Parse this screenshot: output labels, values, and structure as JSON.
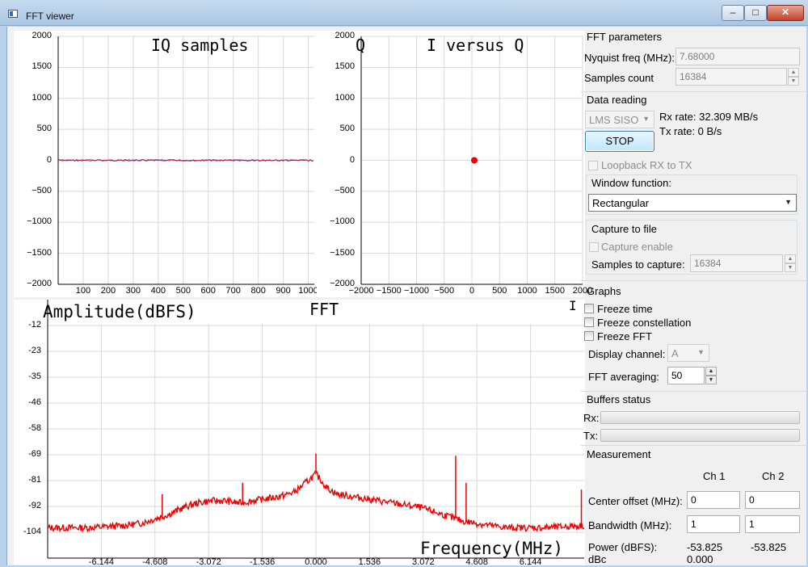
{
  "window": {
    "title": "FFT viewer",
    "minimize": "–",
    "maximize": "□",
    "close": "✕"
  },
  "colors": {
    "trace_red": "#ee0000",
    "trace_blue": "#4040c0",
    "grid": "#d8d8d8"
  },
  "plots": {
    "iq": {
      "title": "IQ samples",
      "y_ticks": [
        "2000",
        "1500",
        "1000",
        "500",
        "0",
        "−500",
        "−1000",
        "−1500",
        "−2000"
      ],
      "x_ticks": [
        "100",
        "200",
        "300",
        "400",
        "500",
        "600",
        "700",
        "800",
        "900",
        "1000"
      ],
      "ylim": [
        -2000,
        2000
      ],
      "xlim": [
        0,
        1024
      ]
    },
    "ivq": {
      "title": "I versus Q",
      "axis_label": "Q",
      "y_ticks": [
        "2000",
        "1500",
        "1000",
        "500",
        "0",
        "−500",
        "−1000",
        "−1500",
        "−2000"
      ],
      "x_ticks": [
        "−2000",
        "−1500",
        "−1000",
        "−500",
        "0",
        "500",
        "1000",
        "1500",
        "2000"
      ],
      "point": {
        "i": 0,
        "q": 0
      }
    },
    "fft": {
      "title": "FFT",
      "ylabel": "Amplitude(dBFS)",
      "xlabel": "Frequency(MHz)",
      "y_ticks": [
        "-12",
        "-23",
        "-35",
        "-46",
        "-58",
        "-69",
        "-81",
        "-92",
        "-104"
      ],
      "x_ticks": [
        "-6.144",
        "-4.608",
        "-3.072",
        "-1.536",
        "0.000",
        "1.536",
        "3.072",
        "4.608",
        "6.144"
      ]
    }
  },
  "chart_data": [
    {
      "type": "line",
      "title": "IQ samples",
      "xlim": [
        0,
        1024
      ],
      "ylim": [
        -2000,
        2000
      ],
      "series": [
        {
          "name": "",
          "x": [
            0,
            1024
          ],
          "values": [
            0,
            0
          ]
        }
      ]
    },
    {
      "type": "scatter",
      "title": "I versus Q",
      "xlim": [
        -2000,
        2000
      ],
      "ylim": [
        -2000,
        2000
      ],
      "series": [
        {
          "name": "",
          "x": [
            0
          ],
          "values": [
            0
          ]
        }
      ]
    },
    {
      "type": "line",
      "title": "FFT",
      "xlabel": "Frequency(MHz)",
      "ylabel": "Amplitude(dBFS)",
      "xlim": [
        -7.68,
        7.68
      ],
      "ylim": [
        -110,
        -5
      ],
      "series": [
        {
          "name": "",
          "x": [
            -7.68,
            -6.5,
            -5.5,
            -5.0,
            -4.6,
            -4.2,
            -3.8,
            -3.4,
            -3.0,
            -2.6,
            -2.2,
            -1.8,
            -1.4,
            -1.0,
            -0.6,
            -0.3,
            0.0,
            0.3,
            0.6,
            1.0,
            1.4,
            1.8,
            2.2,
            2.6,
            3.0,
            3.4,
            3.8,
            4.2,
            4.6,
            5.0,
            5.5,
            6.5,
            7.68
          ],
          "values": [
            -102,
            -102,
            -101,
            -100,
            -98,
            -96,
            -93,
            -91,
            -90,
            -90,
            -91,
            -90,
            -89,
            -88,
            -86,
            -82,
            -78,
            -84,
            -87,
            -88,
            -89,
            -90,
            -91,
            -92,
            -93,
            -95,
            -97,
            -99,
            -100,
            -101,
            -102,
            -102,
            -101
          ]
        }
      ],
      "spurs": [
        {
          "x": -4.4,
          "y": -87
        },
        {
          "x": -2.1,
          "y": -82
        },
        {
          "x": 0.0,
          "y": -69
        },
        {
          "x": 4.0,
          "y": -70
        },
        {
          "x": 4.3,
          "y": -82
        },
        {
          "x": 7.6,
          "y": -85
        }
      ]
    }
  ],
  "fft_params": {
    "group": "FFT parameters",
    "nyquist_label": "Nyquist freq (MHz):",
    "nyquist_value": "7.68000",
    "samples_label": "Samples count",
    "samples_value": "16384"
  },
  "data_reading": {
    "group": "Data reading",
    "device": "LMS SISO",
    "rx_rate": "Rx rate: 32.309 MB/s",
    "tx_rate": "Tx rate: 0 B/s",
    "stop_label": "STOP",
    "loopback_label": "Loopback RX to TX"
  },
  "window_function": {
    "label": "Window function:",
    "value": "Rectangular"
  },
  "capture": {
    "group": "Capture to file",
    "enable_label": "Capture enable",
    "samples_label": "Samples to capture:",
    "samples_value": "16384"
  },
  "graphs": {
    "group": "Graphs",
    "freeze_time": "Freeze time",
    "freeze_constellation": "Freeze constellation",
    "freeze_fft": "Freeze FFT",
    "channel_label": "Display channel:",
    "channel_value": "A",
    "averaging_label": "FFT averaging:",
    "averaging_value": "50"
  },
  "buffers": {
    "group": "Buffers status",
    "rx_label": "Rx:",
    "tx_label": "Tx:"
  },
  "measurement": {
    "group": "Measurement",
    "col1": "Ch 1",
    "col2": "Ch 2",
    "center_label": "Center offset (MHz):",
    "center_ch1": "0",
    "center_ch2": "0",
    "bw_label": "Bandwidth (MHz):",
    "bw_ch1": "1",
    "bw_ch2": "1",
    "power_label": "Power (dBFS):",
    "power_ch1": "-53.825",
    "power_ch2": "-53.825",
    "dbc_label": "dBc",
    "dbc_value": "0.000"
  }
}
